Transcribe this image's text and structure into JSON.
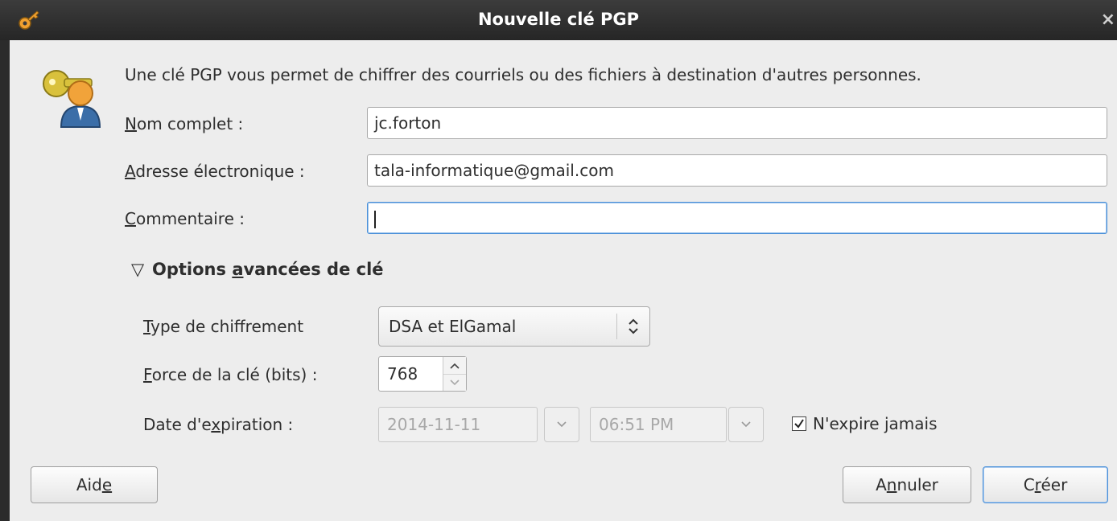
{
  "window": {
    "title": "Nouvelle clé PGP",
    "close_glyph": "×"
  },
  "icons": {
    "app": "key-icon",
    "dialog": "keys-person-icon",
    "close": "close-icon"
  },
  "description": "Une clé PGP vous permet de chiffrer des courriels ou des fichiers à destination d'autres personnes.",
  "form": {
    "name_label_mnemonic": "N",
    "name_label_rest": "om complet :",
    "name_value": "jc.forton",
    "email_label_mnemonic": "A",
    "email_label_rest": "dresse électronique :",
    "email_value": "tala-informatique@gmail.com",
    "comment_label_mnemonic": "C",
    "comment_label_rest": "ommentaire :",
    "comment_value": ""
  },
  "advanced": {
    "expander_glyph": "▽",
    "label_pre": "Options ",
    "label_mnemonic": "a",
    "label_post": "vancées de clé",
    "type_label_mnemonic": "T",
    "type_label_rest": "ype de chiffrement",
    "type_value": "DSA et ElGamal",
    "strength_label_mnemonic": "F",
    "strength_label_rest": "orce de la clé (bits) :",
    "strength_value": "768",
    "expiry_label_pre": "Date d'e",
    "expiry_label_mnemonic": "x",
    "expiry_label_post": "piration :",
    "expiry_date": "2014-11-11",
    "expiry_time": "06:51 PM",
    "never_expire_pre": "N'expire ",
    "never_expire_mnemonic": "j",
    "never_expire_post": "amais",
    "never_expire_checked": true
  },
  "buttons": {
    "help_pre": "Aid",
    "help_mnemonic": "e",
    "cancel_pre": "A",
    "cancel_mnemonic": "n",
    "cancel_post": "nuler",
    "create_pre": "C",
    "create_mnemonic": "r",
    "create_post": "éer"
  },
  "colors": {
    "focus": "#4a90d9",
    "titlebar": "#2d2d2d",
    "dialog_bg": "#ededed"
  }
}
